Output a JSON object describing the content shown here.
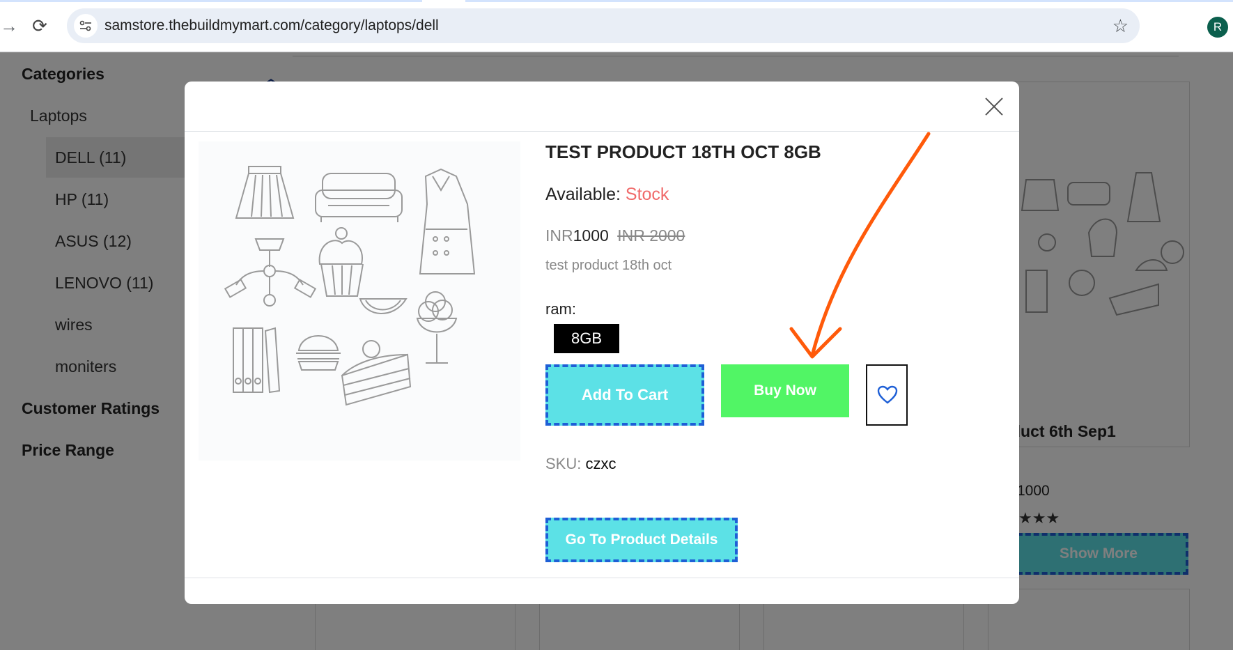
{
  "browser": {
    "url": "samstore.thebuildmymart.com/category/laptops/dell",
    "profile_initial": "R"
  },
  "sidebar": {
    "categories_heading": "Categories",
    "group": "Laptops",
    "items": [
      {
        "label": "DELL (11)",
        "active": true
      },
      {
        "label": "HP (11)"
      },
      {
        "label": "ASUS (12)"
      },
      {
        "label": "LENOVO (11)"
      },
      {
        "label": "wires"
      },
      {
        "label": "moniters"
      }
    ],
    "ratings_heading": "Customer Ratings",
    "price_heading": "Price Range"
  },
  "background_card": {
    "title": "duct 6th Sep1",
    "price": "1000",
    "stars": "★★★",
    "show_more": "Show More"
  },
  "modal": {
    "title": "TEST PRODUCT 18TH OCT 8GB",
    "available_label": "Available:",
    "available_value": "Stock",
    "currency": "INR",
    "price": "1000",
    "old_price": "INR 2000",
    "description": "test product 18th oct",
    "variant_label": "ram:",
    "variant_value": "8GB",
    "add_to_cart": "Add To Cart",
    "buy_now": "Buy Now",
    "sku_label": "SKU:",
    "sku_value": "czxc",
    "go_to_details": "Go To Product Details"
  },
  "colors": {
    "accent_cyan": "#5ce1e6",
    "buy_green": "#51f565",
    "stock_red": "#f06a6a",
    "annotation_arrow": "#ff5a0a"
  }
}
